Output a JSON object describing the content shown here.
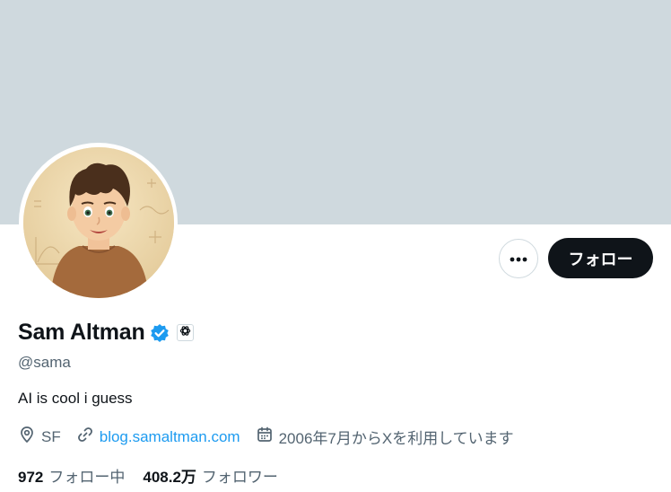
{
  "profile": {
    "display_name": "Sam Altman",
    "handle": "@sama",
    "bio": "AI is cool i guess",
    "location": "SF",
    "website": "blog.samaltman.com",
    "joined": "2006年7月からXを利用しています"
  },
  "actions": {
    "follow_label": "フォロー"
  },
  "stats": {
    "following_count": "972",
    "following_label": "フォロー中",
    "followers_count": "408.2万",
    "followers_label": "フォロワー"
  },
  "colors": {
    "banner": "#cfd9de",
    "verified": "#1d9bf0",
    "link": "#1d9bf0",
    "primary_button": "#0f1419",
    "secondary_text": "#536471"
  }
}
